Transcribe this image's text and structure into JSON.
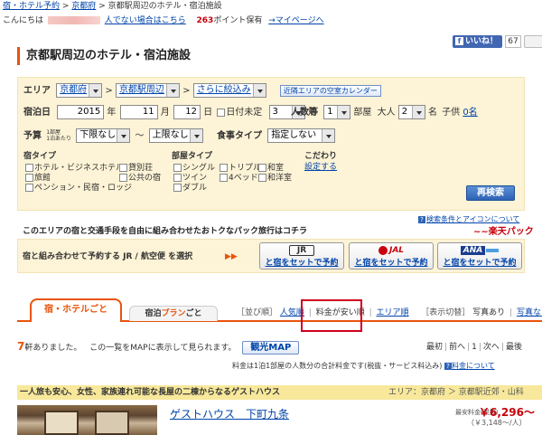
{
  "breadcrumb": [
    "宿・ホテル予約",
    "京都府",
    "京都駅周辺のホテル・宿泊施設"
  ],
  "greeting": {
    "prefix": "こんにちは",
    "guest_note": "人でない場合はこちら",
    "points": "263",
    "points_suffix": "ポイント保有",
    "mypage": "→マイページへ"
  },
  "social": {
    "like_label": "いいね！",
    "like_count": "67"
  },
  "page_title": "京都駅周辺のホテル・宿泊施設",
  "search": {
    "area_label": "エリア",
    "area_pref": "京都府",
    "area_sub": "京都駅周辺",
    "area_narrow": "さらに絞込み",
    "calendar_button": "近隣エリアの空室カレンダー",
    "date_label": "宿泊日",
    "year": "2015",
    "year_unit": "年",
    "month": "11",
    "month_unit": "月",
    "day": "12",
    "day_unit": "日",
    "undecided": "日付未定",
    "nights": "3",
    "nights_unit": "泊",
    "people_label": "人数等",
    "rooms": "1",
    "rooms_unit": "部屋",
    "adults_label": "大人",
    "adults": "2",
    "adults_unit": "名",
    "children_label": "子供",
    "children": "0名",
    "budget_label": "予算",
    "budget_note_1": "1部屋",
    "budget_note_2": "1泊あたり",
    "budget_min": "下限なし",
    "budget_sep": "〜",
    "budget_max": "上限なし",
    "meal_label": "食事タイプ",
    "meal_value": "指定しない",
    "stay_type_label": "宿タイプ",
    "stay_types": [
      "ホテル・ビジネスホテル",
      "貸別荘",
      "旅館",
      "公共の宿",
      "ペンション・民宿・ロッジ"
    ],
    "room_type_label": "部屋タイプ",
    "room_types": [
      "シングル",
      "トリプル",
      "和室",
      "ツイン",
      "4ベッド",
      "和洋室",
      "ダブル"
    ],
    "kodawari_label": "こだわり",
    "kodawari_link": "設定する",
    "research_button": "再検索"
  },
  "search_help": "検索条件とアイコンについて",
  "pack": {
    "banner": "このエリアの宿と交通手段を自由に組み合わせたおトクなパック旅行はコチラ",
    "logo": "楽天パック",
    "tagline": "宿と組み合わせて予約する JR / 航空便 を選択",
    "jr_label": "JR",
    "jal_label": "JAL",
    "ana_label": "ANA",
    "bundle_label": "と宿をセットで予約"
  },
  "tabs": {
    "hotel": "宿・ホテルごと",
    "plan_prefix": "宿泊",
    "plan_mid": "プラン",
    "plan_suffix": "ごと"
  },
  "sort": {
    "label": "［並び順］",
    "popular": "人気順",
    "price": "料金が安い順",
    "area": "エリア順",
    "display_label": "［表示切替］",
    "photo": "写真あり",
    "list": "写真なし"
  },
  "results": {
    "count": "7",
    "count_suffix": "軒ありました。",
    "map_note": "この一覧をMAPに表示して見られます。",
    "map_button": "観光MAP",
    "pager": [
      "最初",
      "前へ",
      "1",
      "次へ",
      "最後"
    ],
    "price_note": "料金は1泊1部屋の人数分の合計料金です(税抜・サービス料込み)",
    "price_note_link": "料金について"
  },
  "listing": {
    "catch": "一人旅も安心、女性、家族連れ可能な長屋の二棟からなるゲストハウス",
    "area_text": "エリア：京都府 ＞ 京都駅近郊・山科",
    "name": "ゲストハウス　下町九条",
    "price_label": "最安料金(税抜)",
    "price": "￥6,296〜",
    "price_tax": "（￥3,148〜/人）"
  }
}
